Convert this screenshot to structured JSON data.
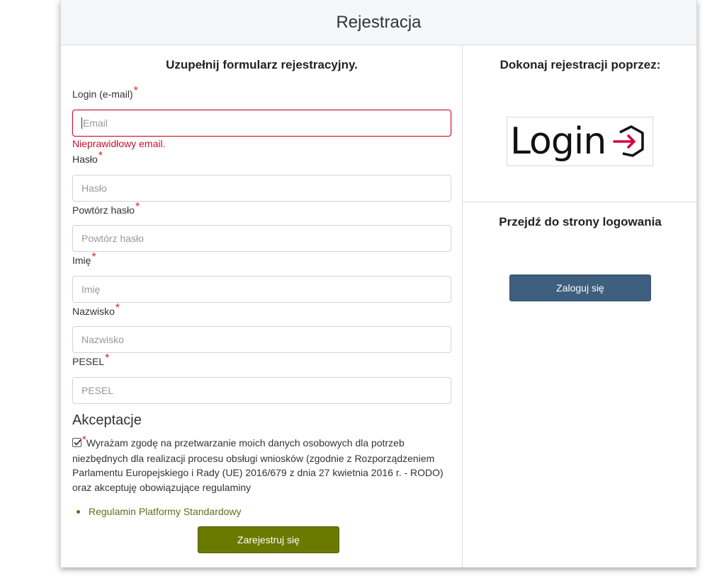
{
  "header": {
    "title": "Rejestracja"
  },
  "form": {
    "title": "Uzupełnij formularz rejestracyjny.",
    "required_mark": "*",
    "login": {
      "label": "Login (e-mail)",
      "placeholder": "Email",
      "value": "",
      "error": "Nieprawidłowy email."
    },
    "password": {
      "label": "Hasło",
      "placeholder": "Hasło"
    },
    "repeat_password": {
      "label": "Powtórz hasło",
      "placeholder": "Powtórz hasło"
    },
    "first_name": {
      "label": "Imię",
      "placeholder": "Imię"
    },
    "last_name": {
      "label": "Nazwisko",
      "placeholder": "Nazwisko"
    },
    "pesel": {
      "label": "PESEL",
      "placeholder": "PESEL"
    }
  },
  "acceptance": {
    "title": "Akceptacje",
    "checked": true,
    "consent_text": "Wyrażam zgodę na przetwarzanie moich danych osobowych dla potrzeb niezbędnych dla realizacji procesu obsługi wniosków (zgodnie z Rozporządzeniem Parlamentu Europejskiego i Rady (UE) 2016/679 z dnia 27 kwietnia 2016 r. - RODO) oraz akceptuję obowiązujące regulaminy",
    "regulations": [
      "Regulamin Platformy Standardowy"
    ]
  },
  "register_button": "Zarejestruj się",
  "sidebar": {
    "register_via_title": "Dokonaj rejestracji poprzez:",
    "provider_logo_text": "Login",
    "goto_login_title": "Przejdź do strony logowania",
    "login_button": "Zaloguj się"
  },
  "colors": {
    "register_button": "#6a7a00",
    "login_button": "#3e5f7d",
    "error": "#c8102e",
    "link": "#5a7314",
    "logo_arrow": "#d6003a"
  }
}
